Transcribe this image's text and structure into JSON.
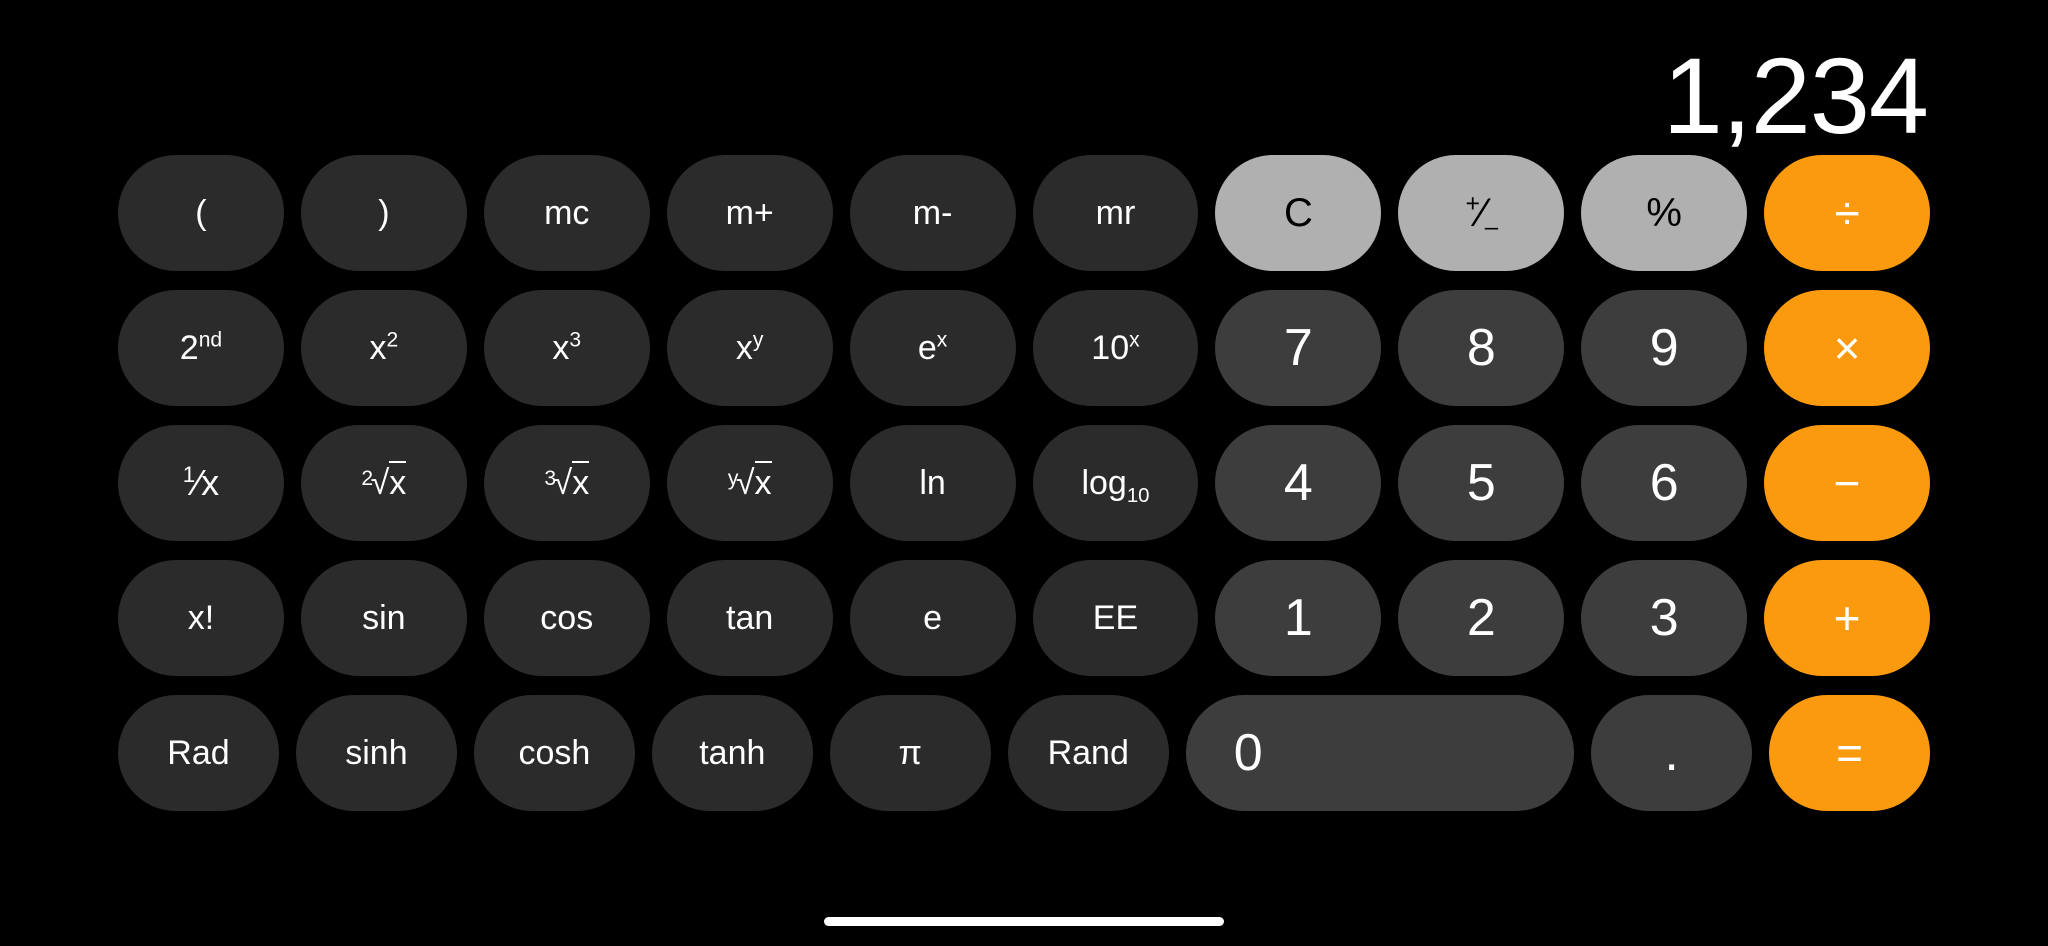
{
  "app": {
    "name": "Calculator",
    "mode": "scientific-landscape",
    "theme": "dark"
  },
  "colors": {
    "background": "#000000",
    "function_key": "#2b2b2b",
    "digit_key": "#3d3d3d",
    "utility_key": "#b0b0b0",
    "operator_key": "#fb9a0e",
    "text_light": "#ffffff",
    "text_dark": "#000000"
  },
  "display": {
    "value": "1,234"
  },
  "keypad": {
    "rows": [
      {
        "keys": [
          {
            "label": "(",
            "name": "key-open-paren",
            "style": "func"
          },
          {
            "label": ")",
            "name": "key-close-paren",
            "style": "func"
          },
          {
            "label": "mc",
            "name": "key-memory-clear",
            "style": "func"
          },
          {
            "label": "m+",
            "name": "key-memory-add",
            "style": "func"
          },
          {
            "label": "m-",
            "name": "key-memory-subtract",
            "style": "func"
          },
          {
            "label": "mr",
            "name": "key-memory-recall",
            "style": "func"
          },
          {
            "label": "C",
            "name": "key-clear",
            "style": "util"
          },
          {
            "label": "+/-",
            "name": "key-sign-toggle",
            "style": "util",
            "render": "plusminus"
          },
          {
            "label": "%",
            "name": "key-percent",
            "style": "util"
          },
          {
            "label": "÷",
            "name": "key-divide",
            "style": "op"
          }
        ]
      },
      {
        "keys": [
          {
            "label": "2nd",
            "name": "key-second-function",
            "style": "func",
            "render": "sup",
            "base": "2",
            "exp": "nd"
          },
          {
            "label": "x2",
            "name": "key-square",
            "style": "func",
            "render": "sup",
            "base": "x",
            "exp": "2"
          },
          {
            "label": "x3",
            "name": "key-cube",
            "style": "func",
            "render": "sup",
            "base": "x",
            "exp": "3"
          },
          {
            "label": "xy",
            "name": "key-power",
            "style": "func",
            "render": "sup",
            "base": "x",
            "exp": "y"
          },
          {
            "label": "ex",
            "name": "key-exp-e",
            "style": "func",
            "render": "sup",
            "base": "e",
            "exp": "x"
          },
          {
            "label": "10x",
            "name": "key-exp-ten",
            "style": "func",
            "render": "sup",
            "base": "10",
            "exp": "x"
          },
          {
            "label": "7",
            "name": "key-7",
            "style": "digit"
          },
          {
            "label": "8",
            "name": "key-8",
            "style": "digit"
          },
          {
            "label": "9",
            "name": "key-9",
            "style": "digit"
          },
          {
            "label": "×",
            "name": "key-multiply",
            "style": "op"
          }
        ]
      },
      {
        "keys": [
          {
            "label": "1/x",
            "name": "key-reciprocal",
            "style": "func",
            "render": "fraction"
          },
          {
            "label": "2√x",
            "name": "key-square-root",
            "style": "func",
            "render": "radical",
            "idx": "2"
          },
          {
            "label": "3√x",
            "name": "key-cube-root",
            "style": "func",
            "render": "radical",
            "idx": "3"
          },
          {
            "label": "y√x",
            "name": "key-nth-root",
            "style": "func",
            "render": "radical",
            "idx": "y"
          },
          {
            "label": "ln",
            "name": "key-natural-log",
            "style": "func"
          },
          {
            "label": "log10",
            "name": "key-log-base-10",
            "style": "func",
            "render": "sub",
            "base": "log",
            "sub": "10"
          },
          {
            "label": "4",
            "name": "key-4",
            "style": "digit"
          },
          {
            "label": "5",
            "name": "key-5",
            "style": "digit"
          },
          {
            "label": "6",
            "name": "key-6",
            "style": "digit"
          },
          {
            "label": "−",
            "name": "key-subtract",
            "style": "op"
          }
        ]
      },
      {
        "keys": [
          {
            "label": "x!",
            "name": "key-factorial",
            "style": "func"
          },
          {
            "label": "sin",
            "name": "key-sine",
            "style": "func"
          },
          {
            "label": "cos",
            "name": "key-cosine",
            "style": "func"
          },
          {
            "label": "tan",
            "name": "key-tangent",
            "style": "func"
          },
          {
            "label": "e",
            "name": "key-euler-number",
            "style": "func"
          },
          {
            "label": "EE",
            "name": "key-scientific-notation",
            "style": "func"
          },
          {
            "label": "1",
            "name": "key-1",
            "style": "digit"
          },
          {
            "label": "2",
            "name": "key-2",
            "style": "digit"
          },
          {
            "label": "3",
            "name": "key-3",
            "style": "digit"
          },
          {
            "label": "+",
            "name": "key-add",
            "style": "op"
          }
        ]
      },
      {
        "keys": [
          {
            "label": "Rad",
            "name": "key-radian-mode",
            "style": "func"
          },
          {
            "label": "sinh",
            "name": "key-hyperbolic-sine",
            "style": "func"
          },
          {
            "label": "cosh",
            "name": "key-hyperbolic-cosine",
            "style": "func"
          },
          {
            "label": "tanh",
            "name": "key-hyperbolic-tangent",
            "style": "func"
          },
          {
            "label": "π",
            "name": "key-pi",
            "style": "func"
          },
          {
            "label": "Rand",
            "name": "key-random",
            "style": "func"
          },
          {
            "label": "0",
            "name": "key-0",
            "style": "digit",
            "wide": true
          },
          {
            "label": ".",
            "name": "key-decimal-point",
            "style": "digit"
          },
          {
            "label": "=",
            "name": "key-equals",
            "style": "op"
          }
        ]
      }
    ]
  },
  "home_indicator": {
    "name": "home-indicator"
  }
}
